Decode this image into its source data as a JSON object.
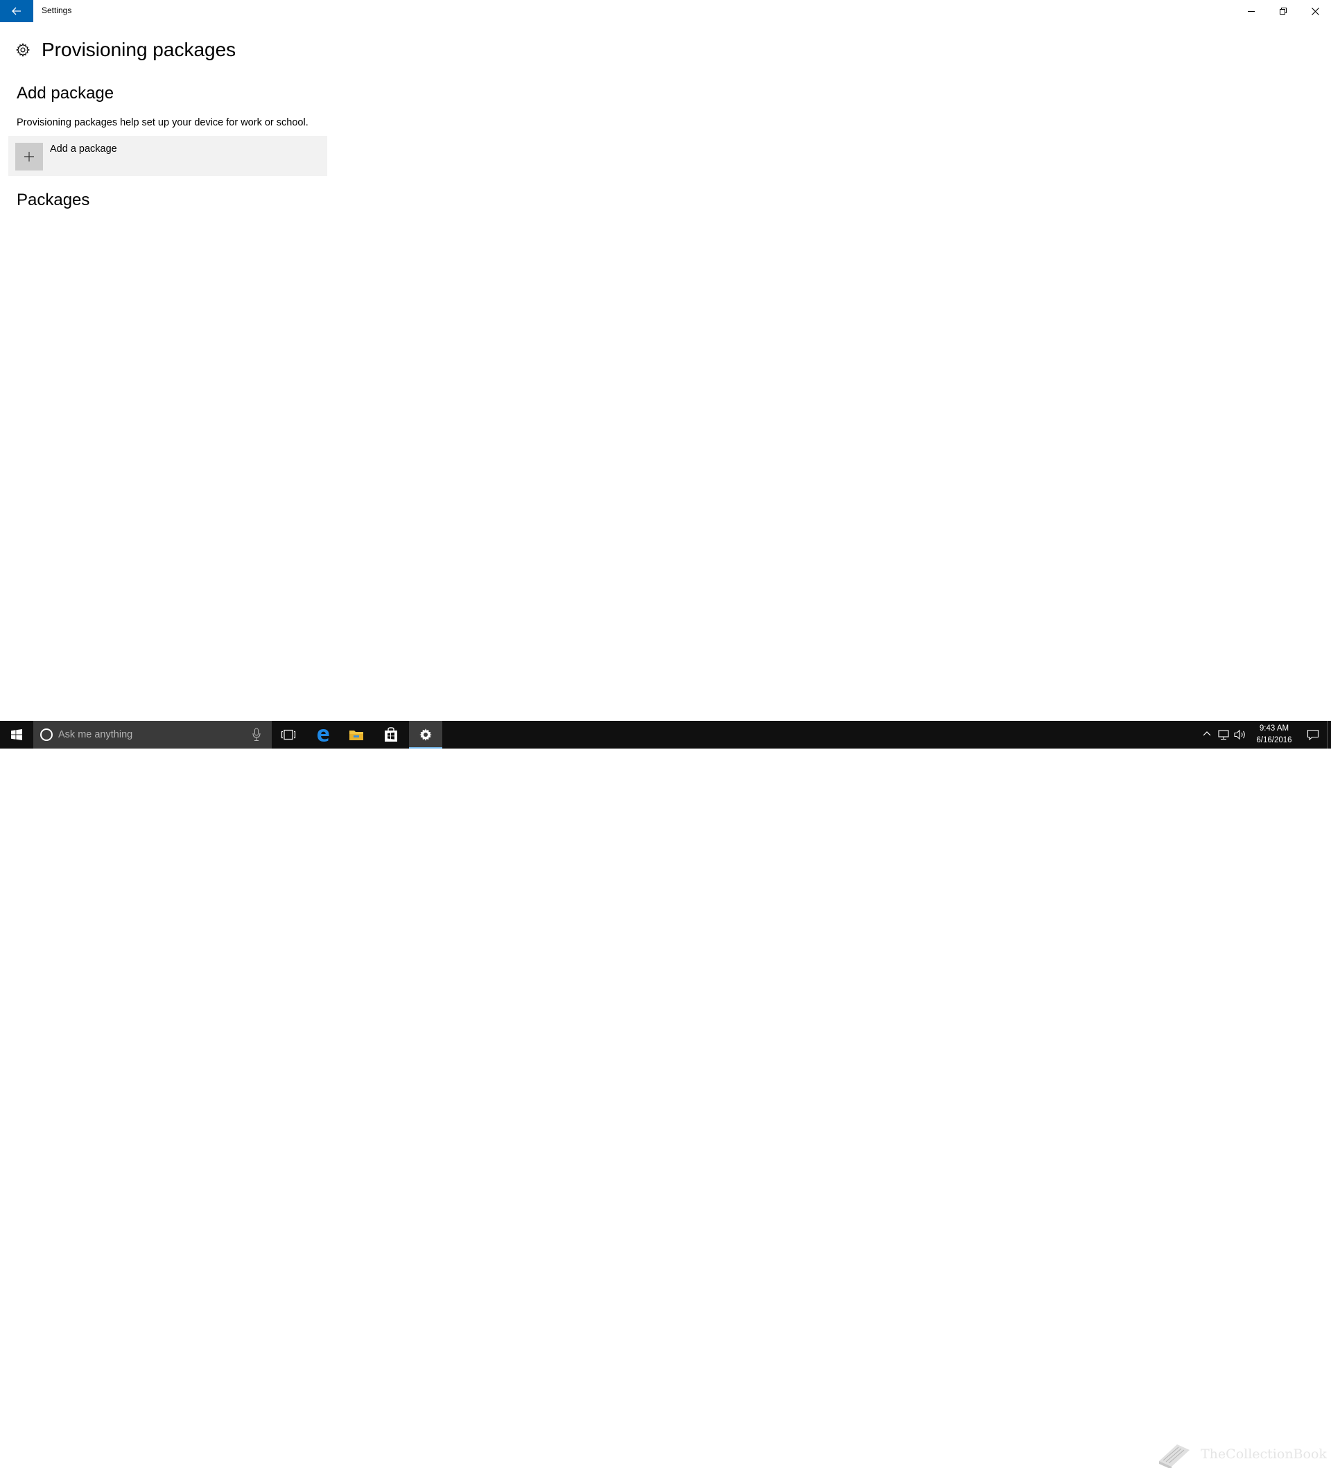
{
  "window": {
    "app_title": "Settings"
  },
  "page": {
    "title": "Provisioning packages",
    "add_section_title": "Add package",
    "description": "Provisioning packages help set up your device for work or school.",
    "add_tile_label": "Add a package",
    "packages_section_title": "Packages"
  },
  "taskbar": {
    "search_placeholder": "Ask me anything",
    "pinned_icons": [
      "task-view-icon",
      "edge-icon",
      "file-explorer-icon",
      "store-icon",
      "settings-icon"
    ],
    "active_app": "settings-icon"
  },
  "tray": {
    "time": "9:43 AM",
    "date": "6/16/2016"
  },
  "watermark": {
    "text": "TheCollectionBook"
  },
  "colors": {
    "accent": "#0063b1",
    "taskbar": "#101010",
    "tile_bg": "#f2f2f2",
    "tile_icon_bg": "#cccccc"
  }
}
